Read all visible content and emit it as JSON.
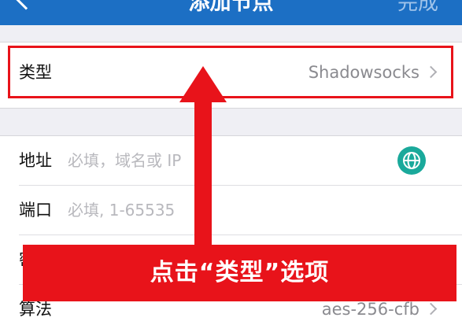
{
  "navbar": {
    "title": "添加节点",
    "done_label": "完成"
  },
  "type_row": {
    "label": "类型",
    "value": "Shadowsocks"
  },
  "address_row": {
    "label": "地址",
    "placeholder": "必填，域名或 IP"
  },
  "port_row": {
    "label": "端口",
    "placeholder": "必填, 1-65535"
  },
  "password_row": {
    "label": "密码"
  },
  "algorithm_row": {
    "label": "算法",
    "value": "aes-256-cfb"
  },
  "annotation": {
    "banner_text": "点击“类型”选项",
    "color": "#e8131a"
  },
  "colors": {
    "navbar": "#1c6fc4",
    "globe": "#1aa99b"
  },
  "icons": {
    "back": "chevron-left-icon",
    "disclosure": "chevron-right-icon",
    "globe": "globe-icon"
  }
}
